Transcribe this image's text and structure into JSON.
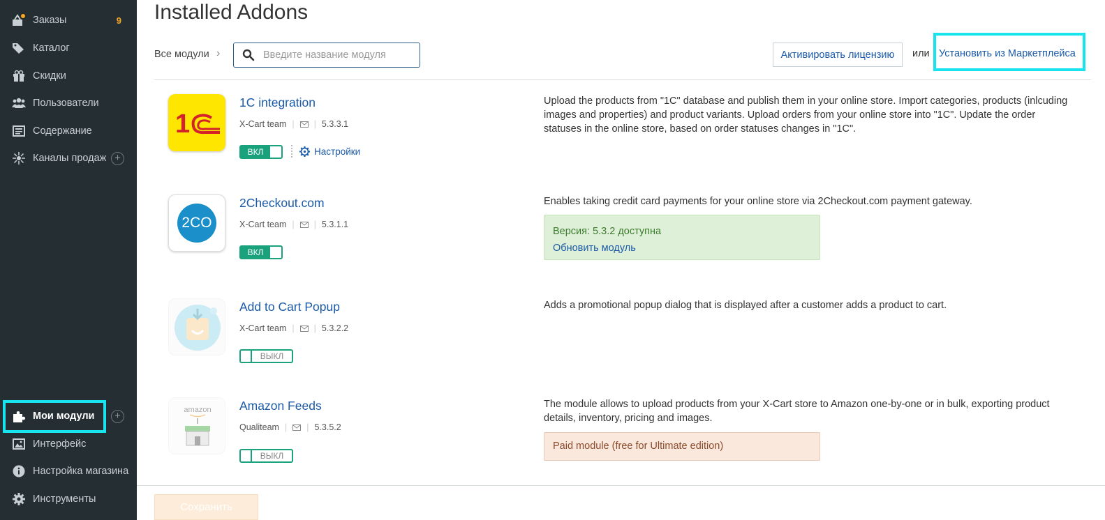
{
  "sidebar": {
    "items": [
      {
        "label": "Заказы",
        "count": "9",
        "icon": "orders-icon"
      },
      {
        "label": "Каталог",
        "icon": "tags-icon"
      },
      {
        "label": "Скидки",
        "icon": "gift-icon"
      },
      {
        "label": "Пользователи",
        "icon": "users-icon"
      },
      {
        "label": "Содержание",
        "icon": "content-icon"
      },
      {
        "label": "Каналы продаж",
        "icon": "channels-icon",
        "plus": "+"
      },
      {
        "label": "Мои модули",
        "icon": "puzzle-icon",
        "plus": "+",
        "active": true
      },
      {
        "label": "Интерфейс",
        "icon": "image-icon"
      },
      {
        "label": "Настройка магазина",
        "icon": "info-icon"
      },
      {
        "label": "Инструменты",
        "icon": "gear-icon"
      }
    ]
  },
  "header": {
    "title": "Installed Addons",
    "breadcrumb": "Все модули",
    "breadcrumb_arrow": "›",
    "search_placeholder": "Введите название модуля",
    "activate_label": "Активировать лицензию",
    "or_text": "или",
    "marketplace_link": "Установить из Маркетплейса"
  },
  "addons": [
    {
      "name": "1C integration",
      "author": "X-Cart team",
      "version": "5.3.3.1",
      "status": "ВКЛ",
      "settings_label": "Настройки",
      "description": "Upload the products from \"1C\" database and publish them in your online store. Import categories, products (inlcuding images and properties) and product variants. Upload orders from your online store into \"1C\". Update the order statuses in the online store, based on order statuses changes in \"1C\"."
    },
    {
      "name": "2Checkout.com",
      "author": "X-Cart team",
      "version": "5.3.1.1",
      "status": "ВКЛ",
      "logo_text": "2CO",
      "description": "Enables taking credit card payments for your online store via 2Checkout.com payment gateway.",
      "update_version": "Версия: 5.3.2 доступна",
      "update_link": "Обновить модуль"
    },
    {
      "name": "Add to Cart Popup",
      "author": "X-Cart team",
      "version": "5.3.2.2",
      "status": "ВЫКЛ",
      "description": "Adds a promotional popup dialog that is displayed after a customer adds a product to cart."
    },
    {
      "name": "Amazon Feeds",
      "author": "Qualiteam",
      "version": "5.3.5.2",
      "status": "ВЫКЛ",
      "logo_text": "amazon",
      "description": "The module allows to upload products from your X-Cart store to Amazon one-by-one or in bulk, exporting product details, inventory, pricing and images.",
      "paid_notice": "Paid module (free for Ultimate edition)"
    }
  ],
  "footer": {
    "save_label": "Сохранить"
  },
  "colors": {
    "sidebar_bg": "#252f33",
    "link": "#1a5aa8",
    "toggle_green": "#1aa27c",
    "highlight": "#19e3ee",
    "count_orange": "#f5a623"
  }
}
